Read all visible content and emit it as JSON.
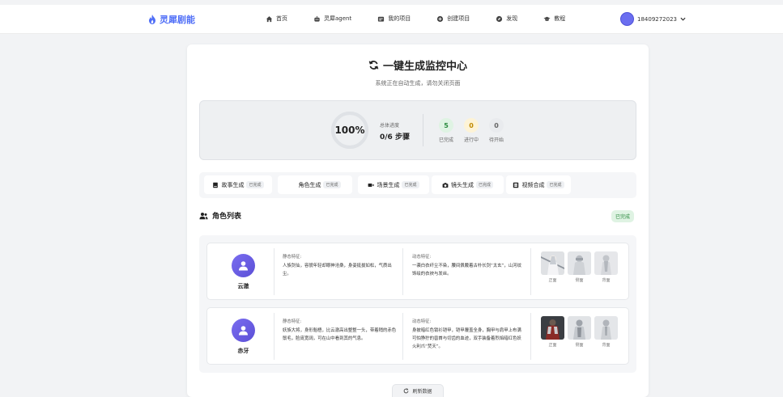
{
  "brand": {
    "name": "灵犀剧能",
    "color": "#4f6ef7"
  },
  "nav": [
    {
      "label": "首页",
      "icon": "home-icon"
    },
    {
      "label": "灵犀agent",
      "icon": "robot-icon"
    },
    {
      "label": "我的项目",
      "icon": "folder-icon"
    },
    {
      "label": "创建项目",
      "icon": "plus-circle-icon"
    },
    {
      "label": "发现",
      "icon": "compass-icon"
    },
    {
      "label": "教程",
      "icon": "graduation-cap-icon"
    }
  ],
  "user": {
    "name": "18409272023"
  },
  "page": {
    "title": "一键生成监控中心",
    "subtitle": "系统正在自动生成，请勿关闭页面"
  },
  "progress": {
    "percent_label": "100%",
    "percent_value": 1.0,
    "overall_label": "总体进度",
    "steps_label": "0/6 步骤",
    "stats": [
      {
        "value": "5",
        "label": "已完成",
        "bg": "#dff3e3",
        "fg": "#2a8a3e"
      },
      {
        "value": "0",
        "label": "进行中",
        "bg": "#fdf3d6",
        "fg": "#c08a00"
      },
      {
        "value": "0",
        "label": "待开始",
        "bg": "#e9ebee",
        "fg": "#666666"
      }
    ]
  },
  "tabs": [
    {
      "label": "故事生成",
      "tag": "已完成",
      "icon": "book-icon",
      "active": false
    },
    {
      "label": "角色生成",
      "tag": "已完成",
      "icon": "users-icon",
      "active": true
    },
    {
      "label": "场景生成",
      "tag": "已完成",
      "icon": "video-icon",
      "active": false
    },
    {
      "label": "镜头生成",
      "tag": "已完成",
      "icon": "camera-icon",
      "active": false
    },
    {
      "label": "视频合成",
      "tag": "已完成",
      "icon": "film-icon",
      "active": false
    }
  ],
  "section": {
    "title": "角色列表",
    "status": "已完成"
  },
  "characters": [
    {
      "name": "云澈",
      "static_label": "静态特征:",
      "static_text": "人族剑仙，容貌年轻却眼神沧桑，身姿挺拔如松，气质出尘。",
      "dynamic_label": "动态特征:",
      "dynamic_text": "一袭白衣纤尘不染，腰间佩戴着古朴长剑“太玄”，山河纹饰绘的衣袂与发丝。",
      "views": [
        "正面",
        "侧面",
        "背面"
      ]
    },
    {
      "name": "赤牙",
      "static_label": "静态特征:",
      "static_text": "妖族大将，身形魁梧，比云澈高出整整一头，带着稍的赤色鬃毛，脸庞宽阔，可在山中看到其的气息。",
      "dynamic_label": "动态特征:",
      "dynamic_text": "身披暗红色锁衫铠甲，铠甲覆盖全身，胸甲与肩甲上布满可怕狰狞的兽首与切齿的血迹，双手装备着烈焰暗红色妖火利爪“焚天”。",
      "views": [
        "正面",
        "侧面",
        "背面"
      ]
    }
  ],
  "refresh_label": "刷新数据"
}
